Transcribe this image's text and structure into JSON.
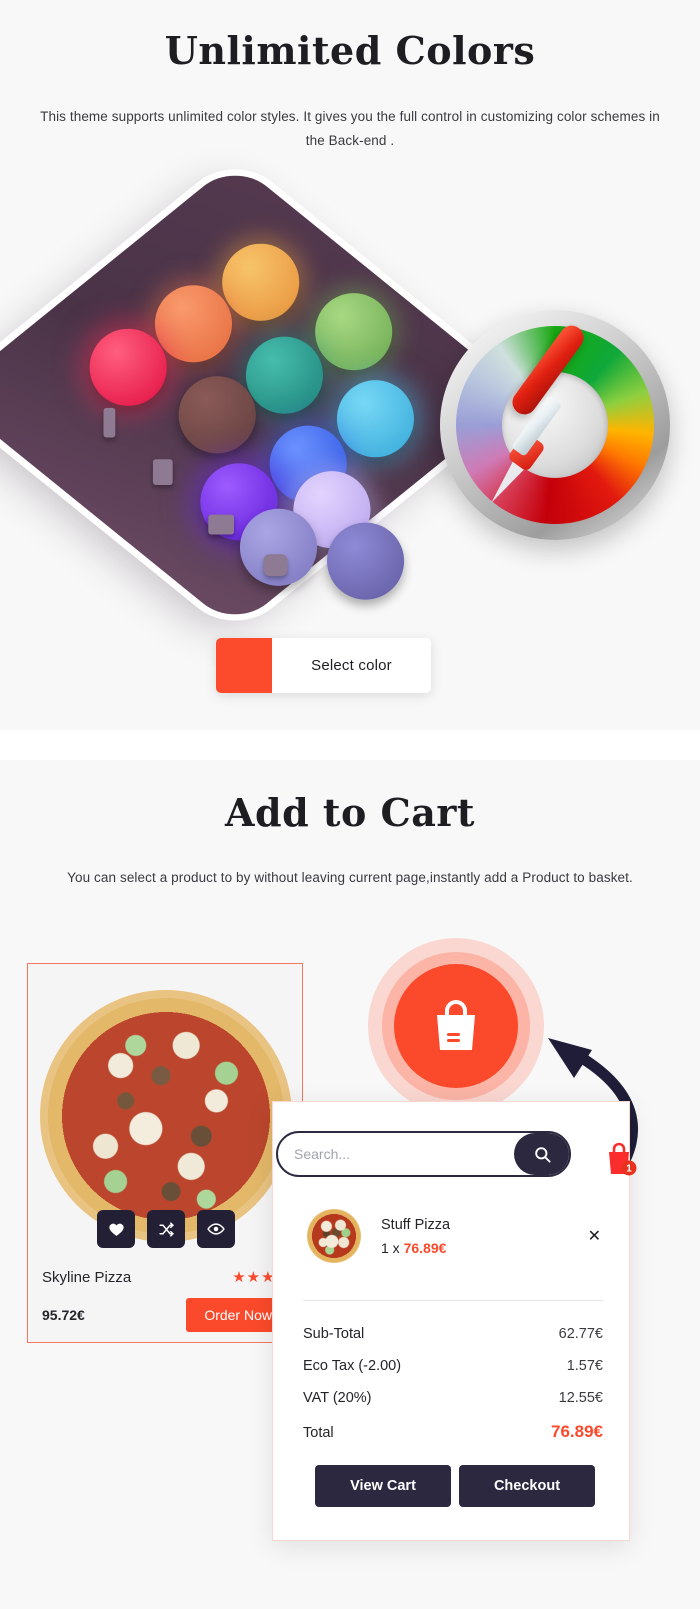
{
  "colors_section": {
    "title": "Unlimited Colors",
    "subtitle": "This theme supports unlimited color styles. It gives you the full control in customizing color schemes in the Back-end .",
    "select_color_label": "Select color",
    "swatch_color": "#fc4a2d",
    "palette_swatches": [
      "#f3a948",
      "#7dbe5e",
      "#f47a4e",
      "#2e9e91",
      "#4fc4ef",
      "#f0315a",
      "#7a4a4a",
      "#3e6cf0",
      "#6d2be0",
      "#cbb6f0",
      "#8f8ad6",
      "#6f6aa8"
    ]
  },
  "cart_section": {
    "title": "Add to Cart",
    "subtitle": "You can select a product to by without leaving current page,instantly add a Product to basket.",
    "product": {
      "name": "Skyline Pizza",
      "price": "95.72€",
      "rating_display": "★★★☆",
      "order_label": "Order Now",
      "actions": [
        "wishlist-icon",
        "compare-icon",
        "quickview-icon"
      ]
    },
    "bag_bubble_icon": "shopping-bag-icon",
    "cart_badge_count": "1",
    "panel": {
      "search_placeholder": "Search...",
      "search_value": "",
      "item": {
        "name": "Stuff Pizza",
        "quantity_price": "1 x ",
        "price": "76.89€",
        "remove_label": "✕"
      },
      "totals": [
        {
          "label": "Sub-Total",
          "value": "62.77€"
        },
        {
          "label": "Eco Tax (-2.00)",
          "value": "1.57€"
        },
        {
          "label": "VAT (20%)",
          "value": "12.55€"
        }
      ],
      "grand_total": {
        "label": "Total",
        "value": "76.89€"
      },
      "view_cart_label": "View Cart",
      "checkout_label": "Checkout"
    }
  },
  "theme": {
    "accent": "#fb4a2b",
    "dark": "#2b2840",
    "page_bg": "#f8f8f8"
  }
}
